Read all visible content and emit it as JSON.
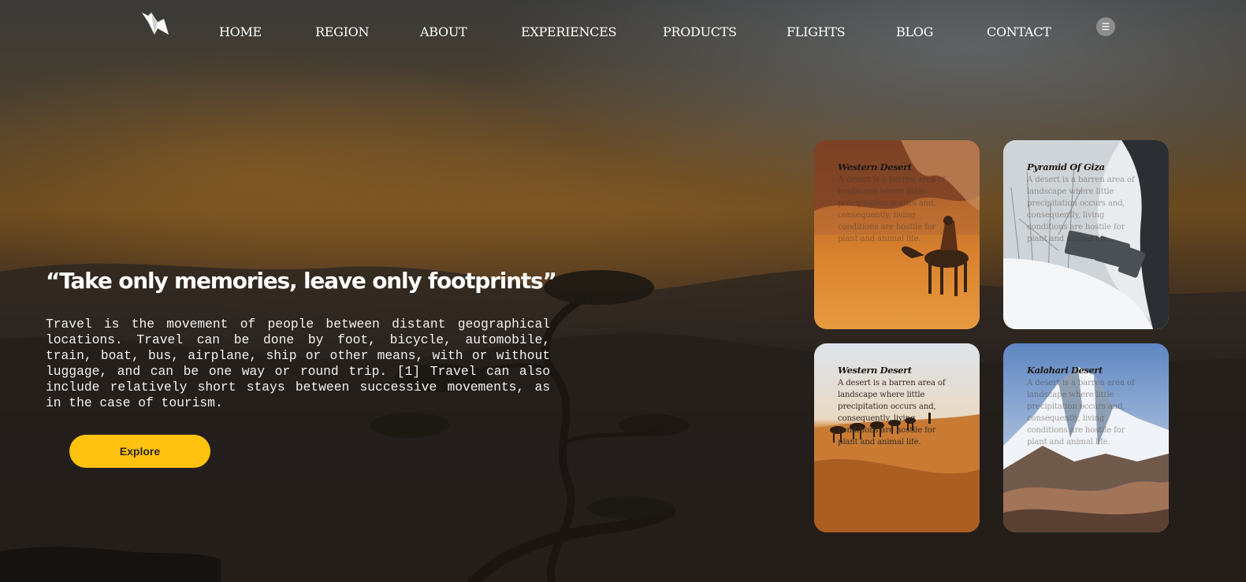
{
  "nav": {
    "links": [
      "HOME",
      "REGION",
      "ABOUT",
      "EXPERIENCES",
      "PRODUCTS",
      "FLIGHTS",
      "BLOG",
      "CONTACT"
    ],
    "menu_icon": "☰"
  },
  "hero": {
    "quote": "“Take only memories, leave only footprints”",
    "description": "Travel is the movement of people between distant geographical locations. Travel can be done by foot, bicycle, automobile, train, boat, bus, airplane, ship or other means, with or without luggage, and can be one way or round trip. [1] Travel can also include relatively short stays between successive movements, as in the case of tourism.",
    "button_label": "Explore"
  },
  "cards": [
    {
      "title": "Western Desert",
      "description": "A desert is a barren area of landscape where little precipitation occurs and, consequently, living conditions are hostile for plant and animal life."
    },
    {
      "title": "Pyramid Of Giza",
      "description": "A desert is a barren area of landscape where little precipitation occurs and, consequently, living conditions are hostile for plant and animal life."
    },
    {
      "title": "Western Desert",
      "description": "A desert is a barren area of landscape where little precipitation occurs and, consequently, living conditions are hostile for plant and animal life."
    },
    {
      "title": "Kalahari Desert",
      "description": "A desert is a barren area of landscape where little precipitation occurs and, consequently, living conditions are hostile for plant and animal life."
    }
  ],
  "colors": {
    "accent": "#ffc20e",
    "text": "#ffffff"
  },
  "icons": {
    "logo": "origami-bird-logo",
    "menu": "menu-icon"
  }
}
